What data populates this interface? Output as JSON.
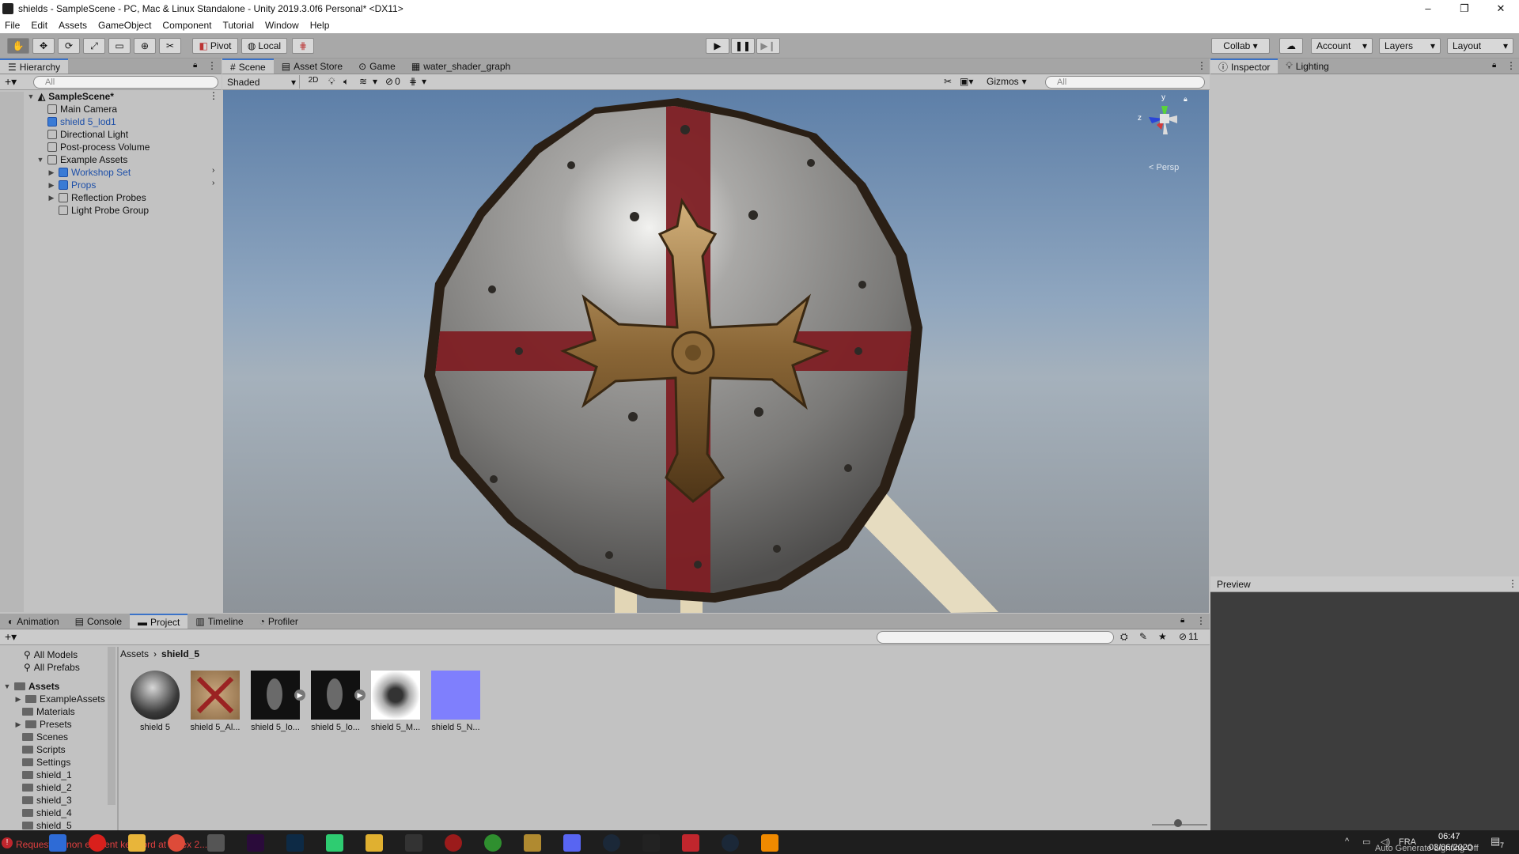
{
  "window": {
    "title": "shields - SampleScene - PC, Mac & Linux Standalone - Unity 2019.3.0f6 Personal* <DX11>",
    "controls": [
      "–",
      "❐",
      "✕"
    ]
  },
  "menu": [
    "File",
    "Edit",
    "Assets",
    "GameObject",
    "Component",
    "Tutorial",
    "Window",
    "Help"
  ],
  "toolbar": {
    "pivot_label": "Pivot",
    "local_label": "Local",
    "collab_label": "Collab ▾",
    "account_label": "Account",
    "layers_label": "Layers",
    "layout_label": "Layout"
  },
  "hierarchy": {
    "tab_label": "Hierarchy",
    "search_placeholder": "All",
    "scene_name": "SampleScene*",
    "items": [
      {
        "label": "Main Camera"
      },
      {
        "label": "shield 5_lod1"
      },
      {
        "label": "Directional Light"
      },
      {
        "label": "Post-process Volume"
      },
      {
        "label": "Example Assets"
      },
      {
        "label": "Workshop Set"
      },
      {
        "label": "Props"
      },
      {
        "label": "Reflection Probes"
      },
      {
        "label": "Light Probe Group"
      }
    ]
  },
  "scene_tabs": [
    "Scene",
    "Asset Store",
    "Game",
    "water_shader_graph"
  ],
  "scene_toolbar": {
    "shading_mode": "Shaded",
    "two_d_label": "2D",
    "hidden_count": "0",
    "gizmos_label": "Gizmos",
    "search_placeholder": "All",
    "persp_label": "< Persp",
    "axis_y": "y",
    "axis_z": "z"
  },
  "inspector": {
    "tabs": [
      "Inspector",
      "Lighting"
    ],
    "preview_label": "Preview"
  },
  "bottom_tabs": [
    "Animation",
    "Console",
    "Project",
    "Timeline",
    "Profiler"
  ],
  "project": {
    "favorites": [
      "All Models",
      "All Prefabs"
    ],
    "root_label": "Assets",
    "folders": [
      "ExampleAssets",
      "Materials",
      "Presets",
      "Scenes",
      "Scripts",
      "Settings",
      "shield_1",
      "shield_2",
      "shield_3",
      "shield_4",
      "shield_5"
    ],
    "breadcrumb_root": "Assets",
    "breadcrumb_current": "shield_5",
    "hidden_count": "11",
    "assets": [
      {
        "label": "shield 5"
      },
      {
        "label": "shield 5_Al..."
      },
      {
        "label": "shield 5_lo..."
      },
      {
        "label": "shield 5_lo..."
      },
      {
        "label": "shield 5_M..."
      },
      {
        "label": "shield 5_N..."
      }
    ]
  },
  "status": {
    "message": "Requesting non existent keyword at index 2...",
    "auto_generate": "Auto Generate Lighting Off"
  },
  "systray": {
    "lang": "FRA",
    "time": "06:47",
    "date": "03/06/2020",
    "notif_count": "7"
  }
}
